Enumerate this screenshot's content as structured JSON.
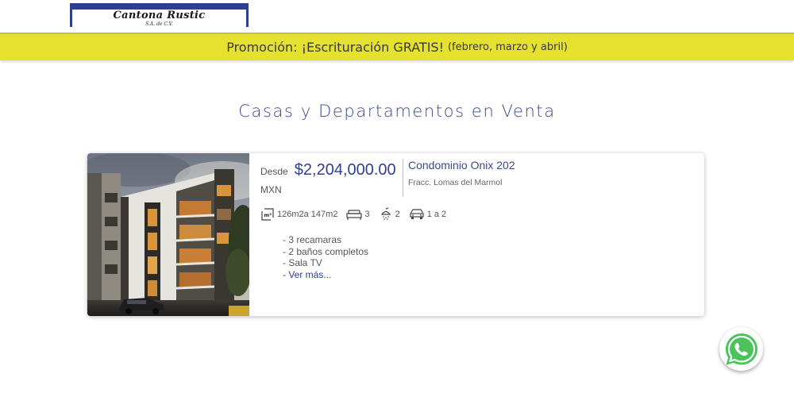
{
  "brand": {
    "name": "Cantona Rustic",
    "tagline": "S.A. de C.V."
  },
  "promo": {
    "main": "Promoción: ¡Escrituración GRATIS!",
    "detail": "(febrero, marzo y abril)"
  },
  "page": {
    "title": "Casas y Departamentos en Venta"
  },
  "listing": {
    "price_prefix": "Desde",
    "price": "$2,204,000.00",
    "currency": "MXN",
    "name": "Condominio Onix 202",
    "location": "Fracc. Lomas del Marmol",
    "features": {
      "area": "126m2a 147m2",
      "bedrooms": "3",
      "bathrooms": "2",
      "parking": "1 a 2"
    },
    "description": [
      "- 3 recamaras",
      "- 2 baños completos",
      "- Sala TV"
    ],
    "more_link": "- Ver más..."
  },
  "icons": {
    "area": "area-m2-icon",
    "bedrooms": "bed-icon",
    "bathrooms": "shower-icon",
    "parking": "car-icon",
    "chat": "whatsapp-icon"
  },
  "colors": {
    "brand_blue": "#2d3f8f",
    "promo_yellow": "#e4e22e",
    "whatsapp_green": "#4ac35a"
  }
}
